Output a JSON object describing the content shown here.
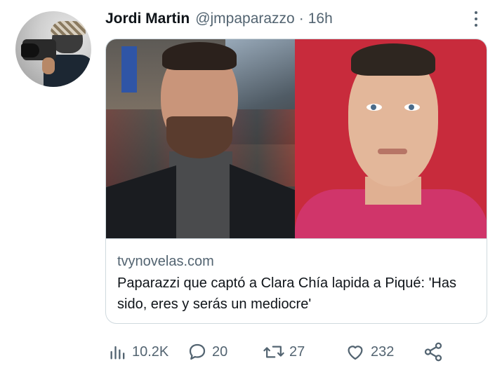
{
  "tweet": {
    "author_name": "Jordi Martin",
    "author_handle": "@jmpaparazzo",
    "separator": "·",
    "time": "16h"
  },
  "card": {
    "domain": "tvynovelas.com",
    "headline": "Paparazzi que captó a Clara Chía lapida a Piqué: 'Has sido, eres y serás un mediocre'"
  },
  "actions": {
    "views": "10.2K",
    "replies": "20",
    "retweets": "27",
    "likes": "232"
  },
  "icons": {
    "more": "more-vertical-icon",
    "views": "analytics-icon",
    "reply": "reply-icon",
    "retweet": "retweet-icon",
    "like": "heart-icon",
    "share": "share-icon"
  },
  "colors": {
    "text": "#0f1419",
    "secondary": "#536471",
    "border": "#cfd9de"
  }
}
